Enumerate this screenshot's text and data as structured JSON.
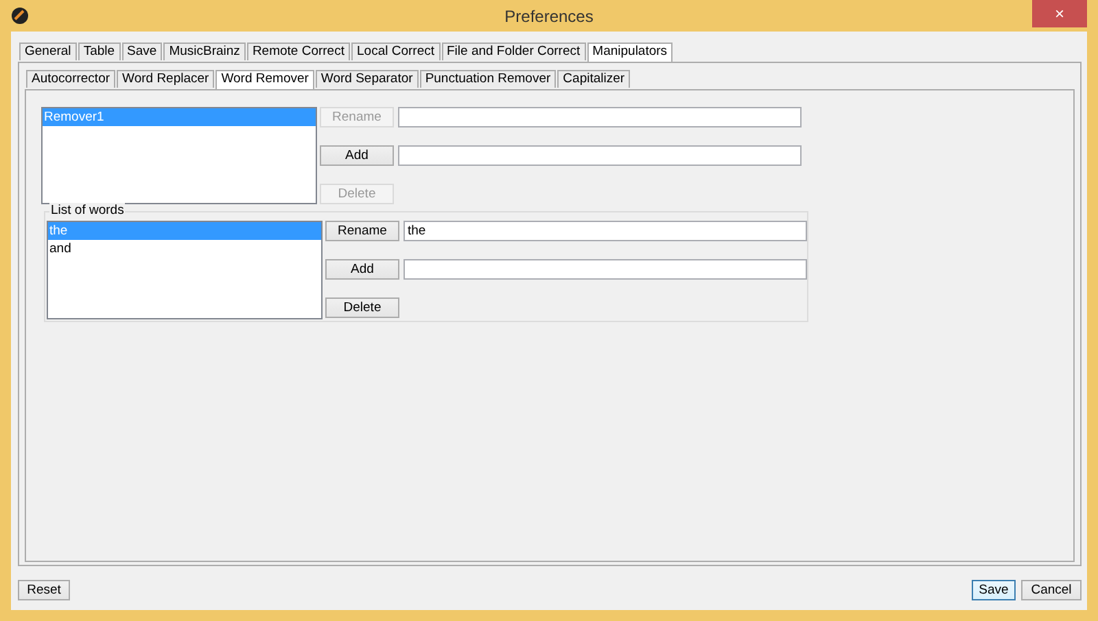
{
  "window": {
    "title": "Preferences",
    "close": "×"
  },
  "tabs": [
    {
      "label": "General",
      "selected": false
    },
    {
      "label": "Table",
      "selected": false
    },
    {
      "label": "Save",
      "selected": false
    },
    {
      "label": "MusicBrainz",
      "selected": false
    },
    {
      "label": "Remote Correct",
      "selected": false
    },
    {
      "label": "Local Correct",
      "selected": false
    },
    {
      "label": "File and Folder Correct",
      "selected": false
    },
    {
      "label": "Manipulators",
      "selected": true
    }
  ],
  "subtabs": [
    {
      "label": "Autocorrector",
      "selected": false
    },
    {
      "label": "Word Replacer",
      "selected": false
    },
    {
      "label": "Word Remover",
      "selected": true
    },
    {
      "label": "Word Separator",
      "selected": false
    },
    {
      "label": "Punctuation Remover",
      "selected": false
    },
    {
      "label": "Capitalizer",
      "selected": false
    }
  ],
  "removers": {
    "items": [
      {
        "label": "Remover1",
        "selected": true
      }
    ],
    "rows": [
      {
        "kind": "button-field",
        "button": "Rename",
        "disabled": true
      },
      {
        "kind": "button-field",
        "button": "Add",
        "disabled": false
      },
      {
        "kind": "button",
        "button": "Delete",
        "disabled": true
      }
    ]
  },
  "words": {
    "title": "List of words",
    "items": [
      {
        "label": "the",
        "selected": true
      },
      {
        "label": "and",
        "selected": false
      }
    ],
    "rows": [
      {
        "kind": "button-field",
        "button": "Rename",
        "disabled": false,
        "value": "the"
      },
      {
        "kind": "button-field",
        "button": "Add",
        "disabled": false
      },
      {
        "kind": "button",
        "button": "Delete",
        "disabled": false
      }
    ]
  },
  "footer": {
    "left": [
      {
        "label": "Reset",
        "default": false
      }
    ],
    "right": [
      {
        "label": "Save",
        "default": true
      },
      {
        "label": "Cancel",
        "default": false
      }
    ]
  }
}
